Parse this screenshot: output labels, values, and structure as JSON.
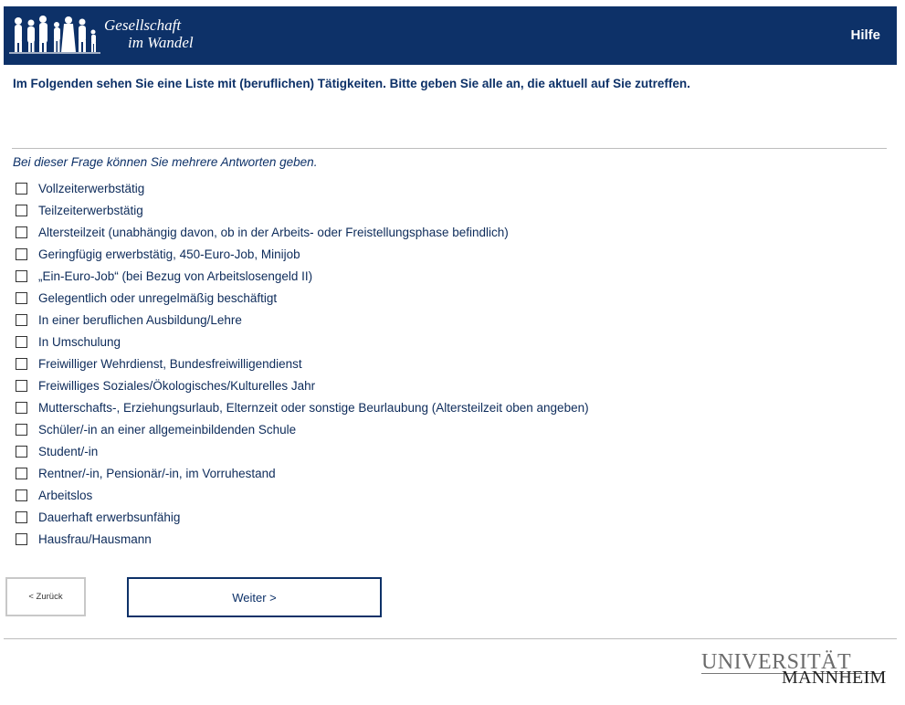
{
  "header": {
    "logo_line1": "Gesellschaft",
    "logo_line2": "im Wandel",
    "help_label": "Hilfe"
  },
  "question": "Im Folgenden sehen Sie eine Liste mit (beruflichen) Tätigkeiten. Bitte geben Sie alle an, die aktuell auf Sie zutreffen.",
  "instruction": "Bei dieser Frage können Sie mehrere Antworten geben.",
  "options": [
    "Vollzeiterwerbstätig",
    "Teilzeiterwerbstätig",
    "Altersteilzeit (unabhängig davon, ob in der Arbeits- oder Freistellungsphase befindlich)",
    "Geringfügig erwerbstätig, 450-Euro-Job, Minijob",
    "„Ein-Euro-Job“ (bei Bezug von Arbeitslosengeld II)",
    "Gelegentlich oder unregelmäßig beschäftigt",
    "In einer beruflichen Ausbildung/Lehre",
    "In Umschulung",
    "Freiwilliger Wehrdienst, Bundesfreiwilligendienst",
    "Freiwilliges Soziales/Ökologisches/Kulturelles Jahr",
    "Mutterschafts-, Erziehungsurlaub, Elternzeit oder sonstige Beurlaubung (Altersteilzeit oben angeben)",
    "Schüler/-in an einer allgemeinbildenden Schule",
    "Student/-in",
    "Rentner/-in, Pensionär/-in, im Vorruhestand",
    "Arbeitslos",
    "Dauerhaft erwerbsunfähig",
    "Hausfrau/Hausmann"
  ],
  "buttons": {
    "back_label": "< Zurück",
    "next_label": "Weiter >"
  },
  "footer": {
    "uni_line1": "UNIVERSITÄT",
    "uni_line2": "MANNHEIM"
  },
  "colors": {
    "header_bg": "#0d3168",
    "text": "#0d2b5a"
  }
}
